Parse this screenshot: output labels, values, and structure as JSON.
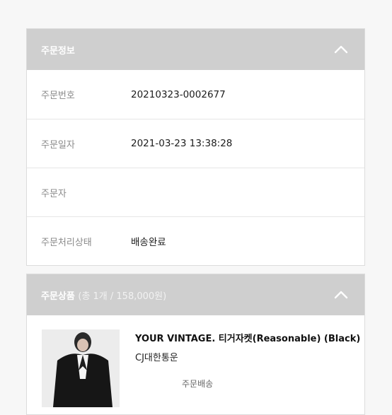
{
  "order_info": {
    "header_title": "주문정보",
    "rows": [
      {
        "label": "주문번호",
        "value": "20210323-0002677"
      },
      {
        "label": "주문일자",
        "value": "2021-03-23 13:38:28"
      },
      {
        "label": "주문자",
        "value": ""
      },
      {
        "label": "주문처리상태",
        "value": "배송완료"
      }
    ]
  },
  "order_products": {
    "header_title": "주문상품",
    "header_summary": "(총 1개 / 158,000원)",
    "product": {
      "name": "YOUR VINTAGE. 티거자켓(Reasonable) (Black)",
      "courier": "CJ대한통운",
      "shipping_label": "주문배송"
    }
  },
  "colors": {
    "header_bg": "#cfcfcf",
    "label_text": "#8a8a8a"
  },
  "icons": [
    "chevron-up-icon"
  ]
}
